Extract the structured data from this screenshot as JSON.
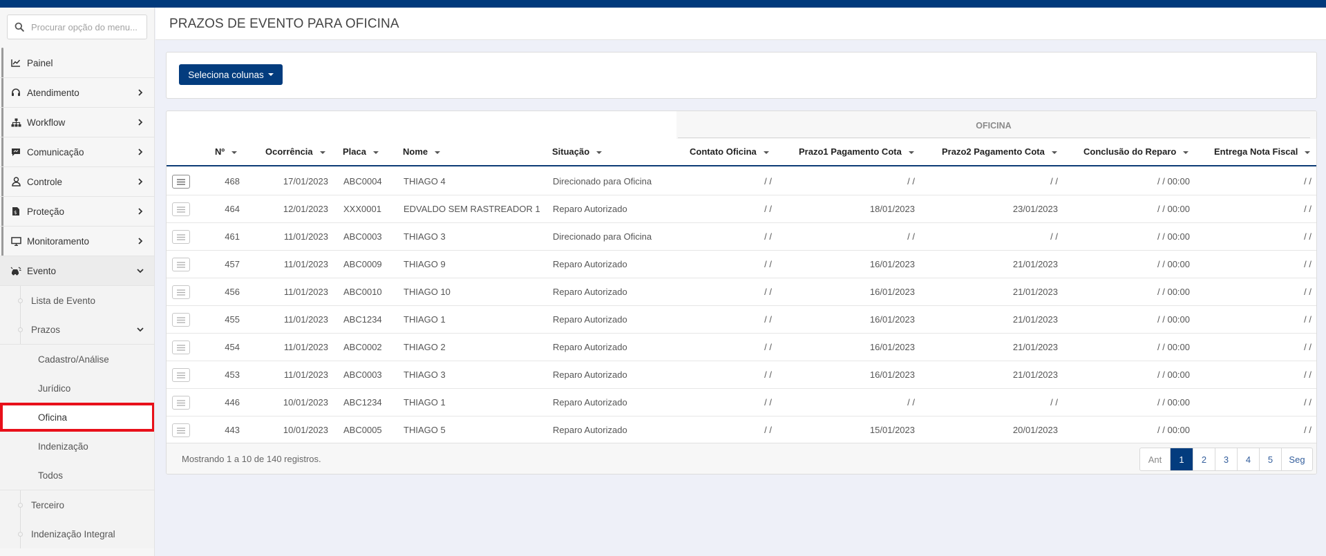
{
  "search": {
    "placeholder": "Procurar opção do menu..."
  },
  "menu": [
    {
      "label": "Painel",
      "icon": "chart-line-icon"
    },
    {
      "label": "Atendimento",
      "icon": "headset-icon"
    },
    {
      "label": "Workflow",
      "icon": "sitemap-icon"
    },
    {
      "label": "Comunicação",
      "icon": "chat-icon"
    },
    {
      "label": "Controle",
      "icon": "user-icon"
    },
    {
      "label": "Proteção",
      "icon": "file-icon"
    },
    {
      "label": "Monitoramento",
      "icon": "monitor-icon"
    },
    {
      "label": "Evento",
      "icon": "car-crash-icon"
    }
  ],
  "evento_sub": {
    "lista": "Lista de Evento",
    "prazos": "Prazos",
    "prazos_items": [
      "Cadastro/Análise",
      "Jurídico",
      "Oficina",
      "Indenização",
      "Todos"
    ],
    "terceiro": "Terceiro",
    "integral": "Indenização Integral"
  },
  "page": {
    "title": "PRAZOS DE EVENTO PARA OFICINA"
  },
  "toolbar": {
    "columns_button": "Seleciona colunas"
  },
  "table": {
    "group_label": "OFICINA",
    "headers": {
      "num": "Nº",
      "ocorrencia": "Ocorrência",
      "placa": "Placa",
      "nome": "Nome",
      "situacao": "Situação",
      "contato": "Contato Oficina",
      "prazo1": "Prazo1 Pagamento Cota",
      "prazo2": "Prazo2 Pagamento Cota",
      "conclusao": "Conclusão do Reparo",
      "entrega": "Entrega Nota Fiscal"
    },
    "rows": [
      {
        "num": "468",
        "ocorrencia": "17/01/2023",
        "placa": "ABC0004",
        "nome": "THIAGO 4",
        "situacao": "Direcionado para Oficina",
        "contato": "/ /",
        "prazo1": "/ /",
        "prazo2": "/ /",
        "conclusao": "/ / 00:00",
        "entrega": "/ /"
      },
      {
        "num": "464",
        "ocorrencia": "12/01/2023",
        "placa": "XXX0001",
        "nome": "EDVALDO SEM RASTREADOR 1",
        "situacao": "Reparo Autorizado",
        "contato": "/ /",
        "prazo1": "18/01/2023",
        "prazo2": "23/01/2023",
        "conclusao": "/ / 00:00",
        "entrega": "/ /"
      },
      {
        "num": "461",
        "ocorrencia": "11/01/2023",
        "placa": "ABC0003",
        "nome": "THIAGO 3",
        "situacao": "Direcionado para Oficina",
        "contato": "/ /",
        "prazo1": "/ /",
        "prazo2": "/ /",
        "conclusao": "/ / 00:00",
        "entrega": "/ /"
      },
      {
        "num": "457",
        "ocorrencia": "11/01/2023",
        "placa": "ABC0009",
        "nome": "THIAGO 9",
        "situacao": "Reparo Autorizado",
        "contato": "/ /",
        "prazo1": "16/01/2023",
        "prazo2": "21/01/2023",
        "conclusao": "/ / 00:00",
        "entrega": "/ /"
      },
      {
        "num": "456",
        "ocorrencia": "11/01/2023",
        "placa": "ABC0010",
        "nome": "THIAGO 10",
        "situacao": "Reparo Autorizado",
        "contato": "/ /",
        "prazo1": "16/01/2023",
        "prazo2": "21/01/2023",
        "conclusao": "/ / 00:00",
        "entrega": "/ /"
      },
      {
        "num": "455",
        "ocorrencia": "11/01/2023",
        "placa": "ABC1234",
        "nome": "THIAGO 1",
        "situacao": "Reparo Autorizado",
        "contato": "/ /",
        "prazo1": "16/01/2023",
        "prazo2": "21/01/2023",
        "conclusao": "/ / 00:00",
        "entrega": "/ /"
      },
      {
        "num": "454",
        "ocorrencia": "11/01/2023",
        "placa": "ABC0002",
        "nome": "THIAGO 2",
        "situacao": "Reparo Autorizado",
        "contato": "/ /",
        "prazo1": "16/01/2023",
        "prazo2": "21/01/2023",
        "conclusao": "/ / 00:00",
        "entrega": "/ /"
      },
      {
        "num": "453",
        "ocorrencia": "11/01/2023",
        "placa": "ABC0003",
        "nome": "THIAGO 3",
        "situacao": "Reparo Autorizado",
        "contato": "/ /",
        "prazo1": "16/01/2023",
        "prazo2": "21/01/2023",
        "conclusao": "/ / 00:00",
        "entrega": "/ /"
      },
      {
        "num": "446",
        "ocorrencia": "10/01/2023",
        "placa": "ABC1234",
        "nome": "THIAGO 1",
        "situacao": "Reparo Autorizado",
        "contato": "/ /",
        "prazo1": "/ /",
        "prazo2": "/ /",
        "conclusao": "/ / 00:00",
        "entrega": "/ /"
      },
      {
        "num": "443",
        "ocorrencia": "10/01/2023",
        "placa": "ABC0005",
        "nome": "THIAGO 5",
        "situacao": "Reparo Autorizado",
        "contato": "/ /",
        "prazo1": "15/01/2023",
        "prazo2": "20/01/2023",
        "conclusao": "/ / 00:00",
        "entrega": "/ /"
      }
    ]
  },
  "footer": {
    "info": "Mostrando 1 a 10 de 140 registros."
  },
  "pagination": {
    "prev": "Ant",
    "pages": [
      "1",
      "2",
      "3",
      "4",
      "5"
    ],
    "next": "Seg",
    "current": "1"
  },
  "colors": {
    "primary": "#033c7e",
    "highlight": "#e8101a"
  }
}
